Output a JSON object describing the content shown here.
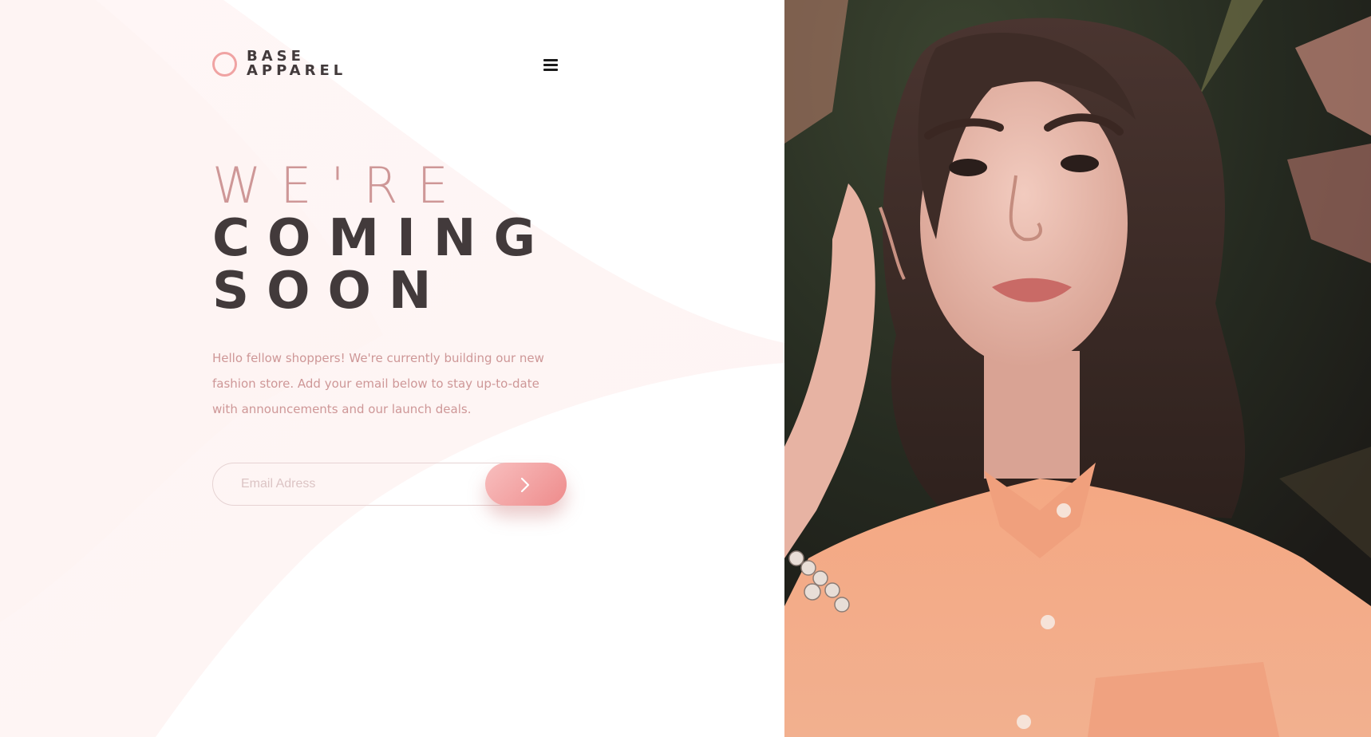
{
  "brand": {
    "line1": "BASE",
    "line2": "APPAREL",
    "accent_color": "#f0a3a3"
  },
  "nav": {
    "menu_icon": "hamburger-icon"
  },
  "hero": {
    "headline_light": "WE'RE",
    "headline_dark_1": "COMING",
    "headline_dark_2": "SOON",
    "description": "Hello fellow shoppers! We're currently building our new fashion store. Add your email below to stay up-to-date with announcements and our launch deals."
  },
  "form": {
    "email_placeholder": "Email Adress",
    "submit_icon": "chevron-right-icon"
  },
  "colors": {
    "text_dark": "#423a3b",
    "text_pink": "#ce9797",
    "button_gradient_start": "#f8bfbf",
    "button_gradient_end": "#ee8b8b"
  }
}
